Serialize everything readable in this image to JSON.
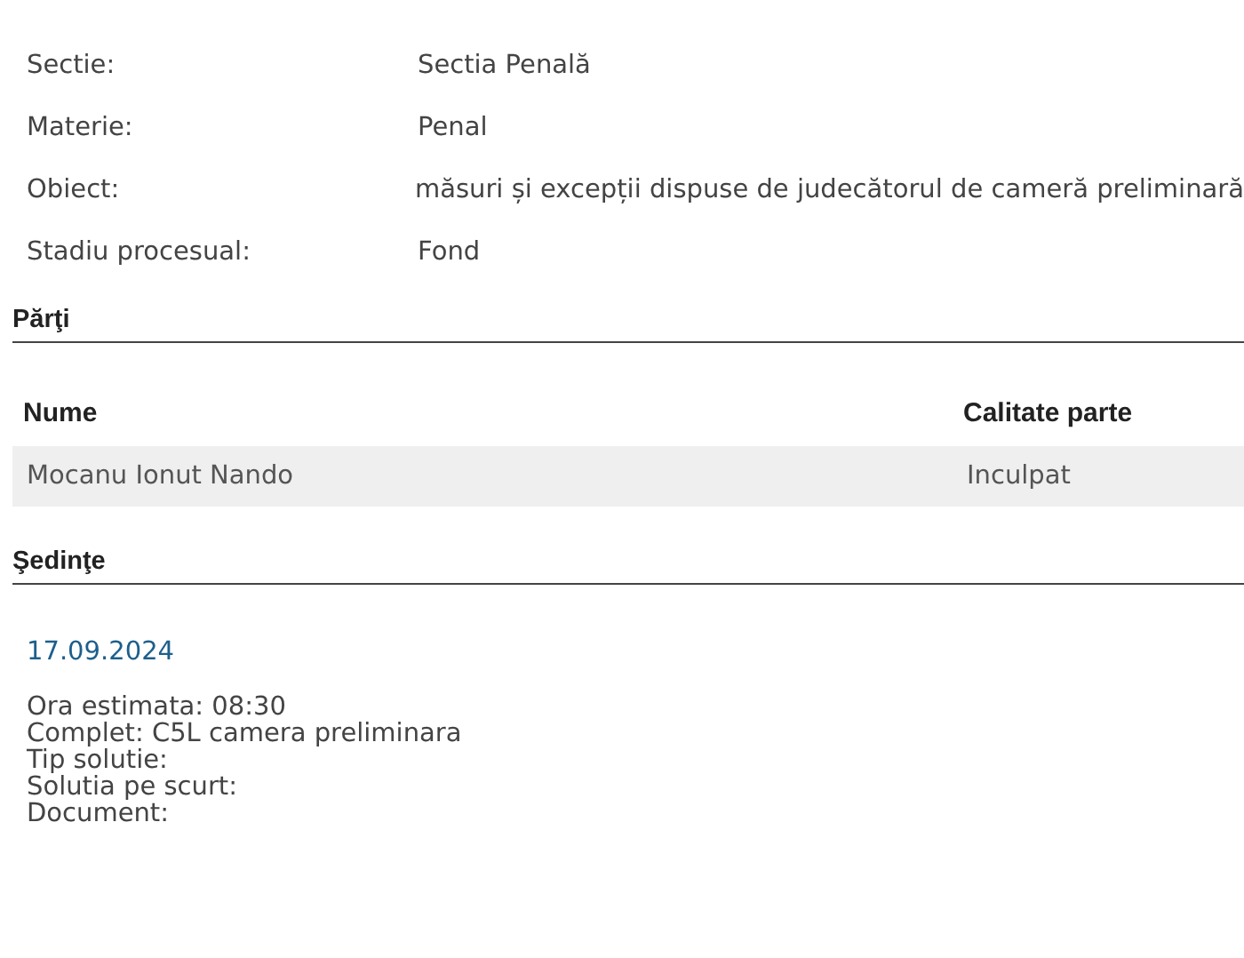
{
  "details": [
    {
      "label": "Sectie:",
      "value": "Sectia Penală"
    },
    {
      "label": "Materie:",
      "value": "Penal"
    },
    {
      "label": "Obiect:",
      "value": "măsuri și excepții dispuse de judecătorul de cameră preliminară"
    },
    {
      "label": "Stadiu procesual:",
      "value": "Fond"
    }
  ],
  "parties": {
    "title": "Părţi",
    "columns": [
      "Nume",
      "Calitate parte"
    ],
    "rows": [
      [
        "Mocanu Ionut Nando",
        "Inculpat"
      ]
    ]
  },
  "hearings": {
    "title": "Şedinţe",
    "items": [
      {
        "date": "17.09.2024",
        "lines": [
          "Ora estimata: 08:30",
          "Complet: C5L camera preliminara",
          "Tip solutie:",
          "Solutia pe scurt:",
          "Document:"
        ]
      }
    ]
  }
}
